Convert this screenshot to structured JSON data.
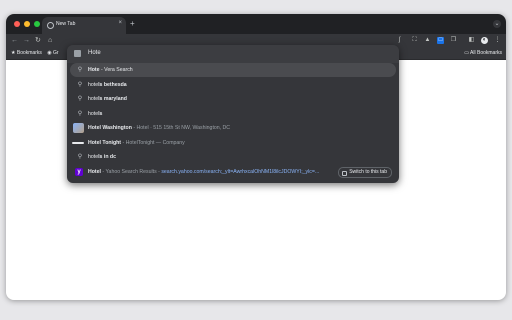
{
  "window": {
    "traffic_colors": [
      "#ff5f57",
      "#febc2e",
      "#28c840"
    ]
  },
  "tab": {
    "title": "New Tab",
    "close_glyph": "×",
    "new_tab_glyph": "+"
  },
  "toolbar": {
    "back_glyph": "←",
    "forward_glyph": "→",
    "reload_glyph": "↻",
    "home_glyph": "⌂"
  },
  "bookmarks": {
    "left_label": "Bookmarks",
    "folder_label": "Gr",
    "right_label": "All Bookmarks"
  },
  "omnibox": {
    "input_text": "Hote",
    "suggestions": [
      {
        "icon": "search-icon",
        "bold": "Hote",
        "rest": " - Vera Search",
        "selected": true
      },
      {
        "icon": "search-icon",
        "normal": "hote",
        "bold": "ls bethesda"
      },
      {
        "icon": "search-icon",
        "normal": "hote",
        "bold": "ls maryland"
      },
      {
        "icon": "search-icon",
        "normal": "hote",
        "bold": "ls"
      },
      {
        "icon": "hotel-thumbnail",
        "bold": "Hotel Washington",
        "sub": " - Hotel · 515 15th St NW, Washington, DC"
      },
      {
        "icon": "hoteltonight-icon",
        "bold": "Hotel Tonight",
        "sub": " - HotelTonight — Company"
      },
      {
        "icon": "search-icon",
        "normal": "hote",
        "bold": "ls in dc"
      },
      {
        "icon": "yahoo-icon",
        "bold": "Hotel",
        "sub": " - Yahoo Search Results - ",
        "url": "search.yahoo.com/search;_ylt=AwrhxcalOhNM1l8ilcJDOWYI;_ylc=...",
        "action": "Switch to this tab"
      }
    ]
  }
}
